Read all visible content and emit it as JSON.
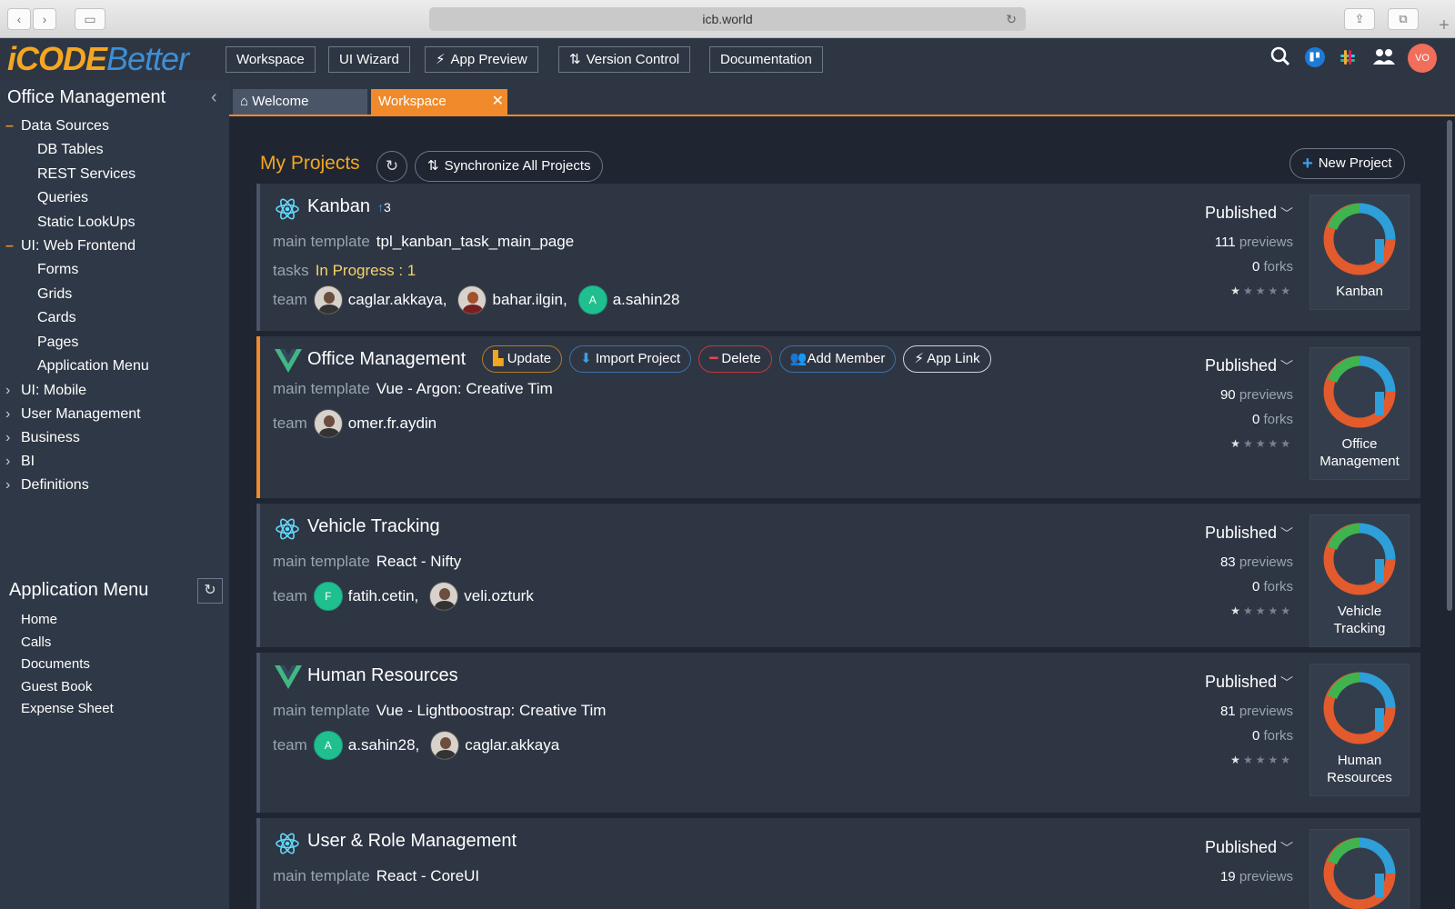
{
  "browser": {
    "url": "icb.world"
  },
  "header": {
    "logo_part1": "iCODE",
    "logo_part2": "Better",
    "menu": [
      {
        "label": "Workspace",
        "icon": ""
      },
      {
        "label": "UI Wizard",
        "icon": ""
      },
      {
        "label": "App Preview",
        "icon": "⚡"
      },
      {
        "label": "Version Control",
        "icon": "⇅"
      },
      {
        "label": "Documentation",
        "icon": ""
      }
    ],
    "user_initials": "VO"
  },
  "sidebar": {
    "title": "Office Management",
    "groups": [
      {
        "label": "Data Sources",
        "expanded": true,
        "items": [
          "DB Tables",
          "REST Services",
          "Queries",
          "Static LookUps"
        ]
      },
      {
        "label": "UI: Web Frontend",
        "expanded": true,
        "items": [
          "Forms",
          "Grids",
          "Cards",
          "Pages",
          "Application Menu"
        ]
      },
      {
        "label": "UI: Mobile",
        "expanded": false,
        "items": []
      },
      {
        "label": "User Management",
        "expanded": false,
        "items": []
      },
      {
        "label": "Business",
        "expanded": false,
        "items": []
      },
      {
        "label": "BI",
        "expanded": false,
        "items": []
      },
      {
        "label": "Definitions",
        "expanded": false,
        "items": []
      }
    ],
    "app_menu_title": "Application Menu",
    "app_menu_items": [
      "Home",
      "Calls",
      "Documents",
      "Guest Book",
      "Expense Sheet"
    ]
  },
  "tabs": [
    {
      "label": "Welcome",
      "active": false
    },
    {
      "label": "Workspace",
      "active": true
    }
  ],
  "main": {
    "title": "My Projects",
    "sync_label": "Synchronize All Projects",
    "new_project_label": "New Project",
    "labels": {
      "main_template": "main template",
      "team": "team",
      "tasks": "tasks",
      "previews": "previews",
      "forks": "forks"
    },
    "actions": [
      "Update",
      "Import Project",
      "Delete",
      "Add Member",
      "App Link"
    ]
  },
  "projects": [
    {
      "name": "Kanban",
      "framework": "react",
      "badge": "3",
      "template": "tpl_kanban_task_main_page",
      "tasks": {
        "status": "In Progress",
        "sep": " : ",
        "count": "1"
      },
      "team": [
        {
          "name": "caglar.akkaya,",
          "avatar": "photo",
          "initial": ""
        },
        {
          "name": "bahar.ilgin,",
          "avatar": "photo-female",
          "initial": ""
        },
        {
          "name": "a.sahin28",
          "avatar": "initial",
          "initial": "A"
        }
      ],
      "status": "Published",
      "previews": "111",
      "forks": "0",
      "rating": 1,
      "thumb": "Kanban"
    },
    {
      "name": "Office Management",
      "framework": "vue",
      "badge": "",
      "template": "Vue - Argon: Creative Tim",
      "team": [
        {
          "name": "omer.fr.aydin",
          "avatar": "photo",
          "initial": ""
        }
      ],
      "status": "Published",
      "previews": "90",
      "forks": "0",
      "rating": 1,
      "thumb": "Office Management"
    },
    {
      "name": "Vehicle Tracking",
      "framework": "react",
      "badge": "",
      "template": "React - Nifty",
      "team": [
        {
          "name": "fatih.cetin,",
          "avatar": "initial",
          "initial": "F"
        },
        {
          "name": "veli.ozturk",
          "avatar": "photo",
          "initial": ""
        }
      ],
      "status": "Published",
      "previews": "83",
      "forks": "0",
      "rating": 1,
      "thumb": "Vehicle Tracking"
    },
    {
      "name": "Human Resources",
      "framework": "vue",
      "badge": "",
      "template": "Vue - Lightboostrap: Creative Tim",
      "team": [
        {
          "name": "a.sahin28,",
          "avatar": "initial",
          "initial": "A"
        },
        {
          "name": "caglar.akkaya",
          "avatar": "photo",
          "initial": ""
        }
      ],
      "status": "Published",
      "previews": "81",
      "forks": "0",
      "rating": 1,
      "thumb": "Human Resources"
    },
    {
      "name": "User & Role Management",
      "framework": "react",
      "badge": "",
      "template": "React - CoreUI",
      "team": [],
      "status": "Published",
      "previews": "19",
      "forks": "",
      "rating": 0,
      "thumb": ""
    }
  ],
  "colors": {
    "accent": "#f08a2a",
    "highlight": "#f4a622",
    "link": "#3d9ee8",
    "sidebar": "#2f3846",
    "card": "#2e3644"
  }
}
